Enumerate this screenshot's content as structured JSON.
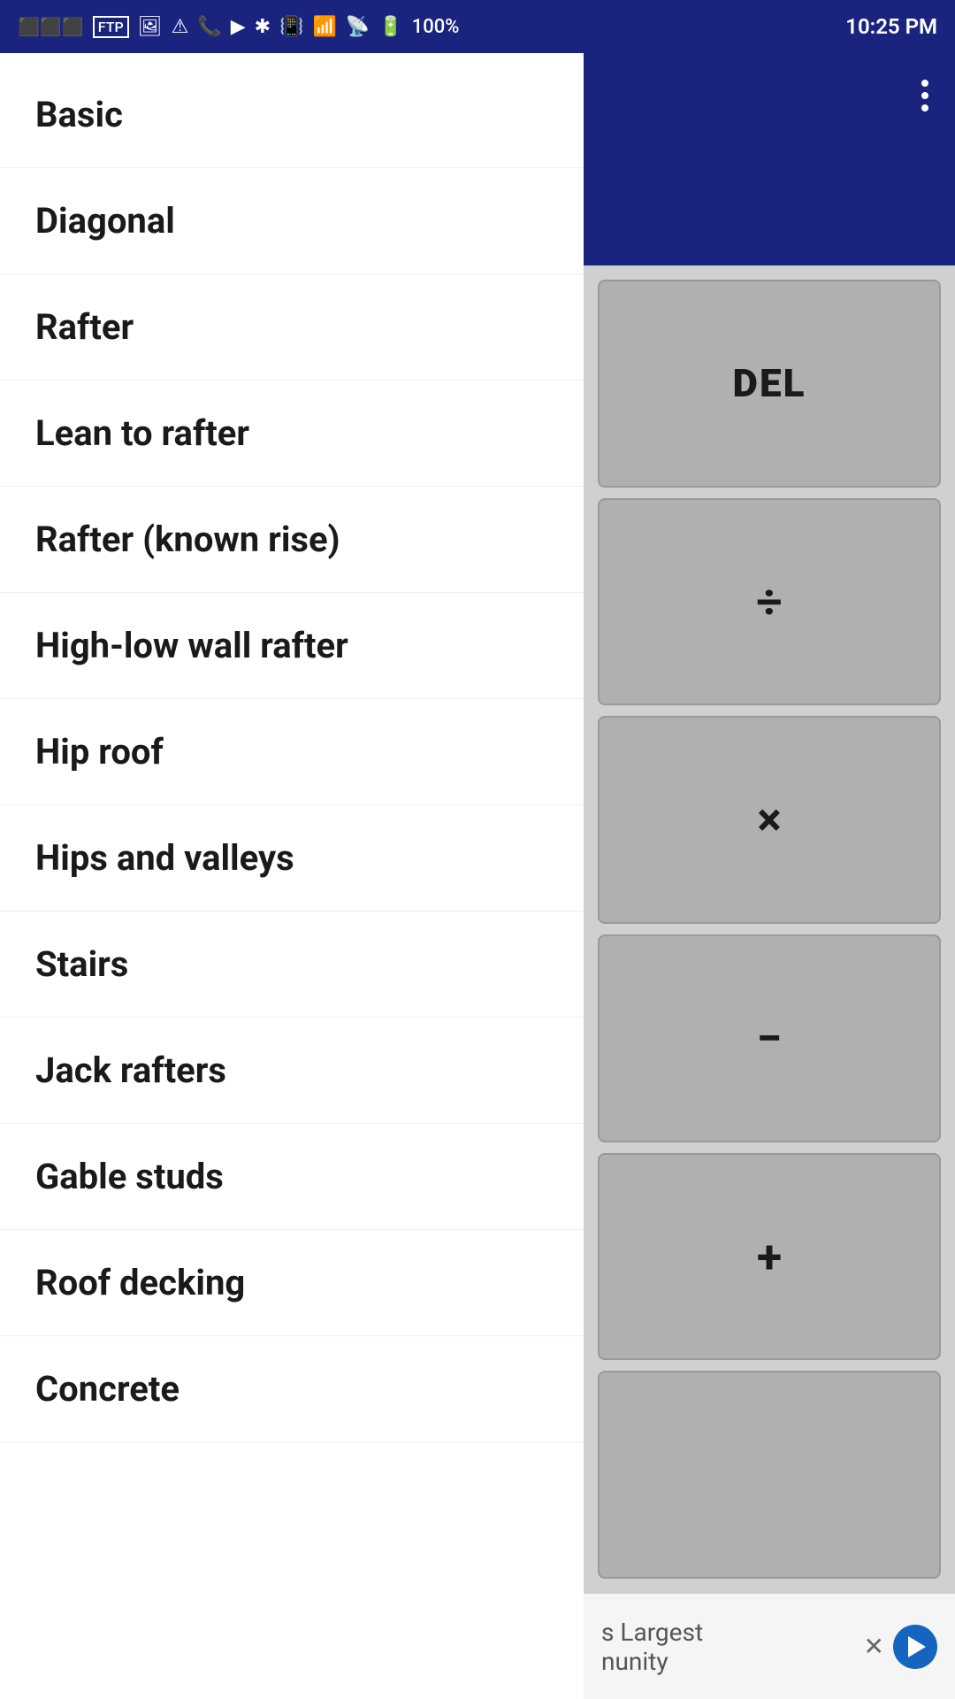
{
  "status_bar": {
    "time": "10:25 PM",
    "battery": "100%",
    "icons": [
      "notification",
      "ftp",
      "image",
      "warning",
      "voicemail",
      "play",
      "bluetooth",
      "vibrate",
      "wifi",
      "signal",
      "battery"
    ]
  },
  "menu": {
    "items": [
      {
        "id": "basic",
        "label": "Basic"
      },
      {
        "id": "diagonal",
        "label": "Diagonal"
      },
      {
        "id": "rafter",
        "label": "Rafter"
      },
      {
        "id": "lean-to-rafter",
        "label": "Lean to rafter"
      },
      {
        "id": "rafter-known-rise",
        "label": "Rafter (known rise)"
      },
      {
        "id": "high-low-wall-rafter",
        "label": "High-low wall rafter"
      },
      {
        "id": "hip-roof",
        "label": "Hip roof"
      },
      {
        "id": "hips-and-valleys",
        "label": "Hips and valleys"
      },
      {
        "id": "stairs",
        "label": "Stairs"
      },
      {
        "id": "jack-rafters",
        "label": "Jack rafters"
      },
      {
        "id": "gable-studs",
        "label": "Gable studs"
      },
      {
        "id": "roof-decking",
        "label": "Roof decking"
      },
      {
        "id": "concrete",
        "label": "Concrete"
      }
    ]
  },
  "calculator": {
    "buttons": [
      {
        "id": "del",
        "label": "DEL",
        "type": "del"
      },
      {
        "id": "divide",
        "label": "÷",
        "type": "operator"
      },
      {
        "id": "multiply",
        "label": "×",
        "type": "operator"
      },
      {
        "id": "subtract",
        "label": "−",
        "type": "operator"
      },
      {
        "id": "add",
        "label": "+",
        "type": "operator"
      },
      {
        "id": "empty",
        "label": "",
        "type": "empty"
      }
    ]
  },
  "ad": {
    "text": "s Largest",
    "subtext": "nunity"
  },
  "three_dots_menu": "⋮"
}
